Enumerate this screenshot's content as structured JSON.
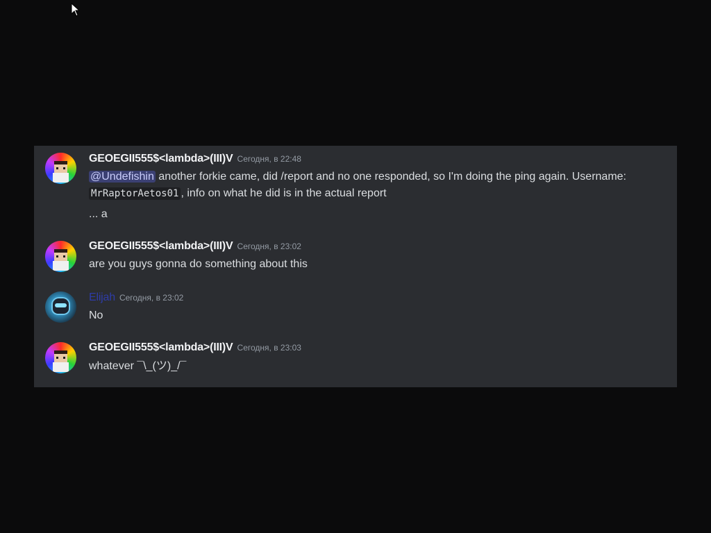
{
  "messages": [
    {
      "username": "GEOEGII555$<lambda>(III)V",
      "timestamp": "Сегодня, в 22:48",
      "mention": "@Undefishin",
      "text_1": " another forkie came, did /report and no one responded, so I'm doing the ping again. Username:",
      "code": "MrRaptorAetos01",
      "text_2": ", info on what he did is in the actual report",
      "followup": "... a"
    },
    {
      "username": "GEOEGII555$<lambda>(III)V",
      "timestamp": "Сегодня, в 23:02",
      "text": "are you guys gonna do something about this"
    },
    {
      "username": "Elijah",
      "timestamp": "Сегодня, в 23:02",
      "text": "No"
    },
    {
      "username": "GEOEGII555$<lambda>(III)V",
      "timestamp": "Сегодня, в 23:03",
      "text": "whatever ¯\\_(ツ)_/¯"
    }
  ],
  "colors": {
    "background": "#0b0b0c",
    "panel": "#2b2d31",
    "username": "#f2f3f5",
    "elijah_name": "#2e3ca8",
    "mention_bg": "#5865f2",
    "timestamp": "#949ba4"
  },
  "icons": {
    "cursor": "mouse-pointer-icon"
  }
}
